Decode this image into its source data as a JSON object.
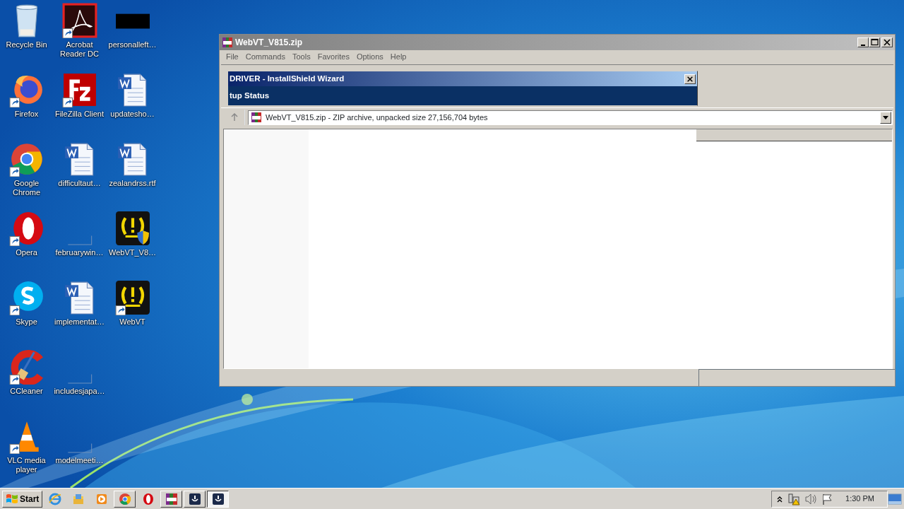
{
  "desktop": {
    "icons": [
      {
        "label": "Recycle Bin",
        "kind": "recycle",
        "shortcut": false
      },
      {
        "label": "Firefox",
        "kind": "firefox",
        "shortcut": true
      },
      {
        "label": "Google Chrome",
        "kind": "chrome",
        "shortcut": true
      },
      {
        "label": "Opera",
        "kind": "opera",
        "shortcut": true
      },
      {
        "label": "Skype",
        "kind": "skype",
        "shortcut": true
      },
      {
        "label": "CCleaner",
        "kind": "ccleaner",
        "shortcut": true
      },
      {
        "label": "VLC media player",
        "kind": "vlc",
        "shortcut": true
      },
      {
        "label": "Acrobat Reader DC",
        "kind": "acrobat",
        "shortcut": true
      },
      {
        "label": "FileZilla Client",
        "kind": "filezilla",
        "shortcut": true
      },
      {
        "label": "difficultaut…",
        "kind": "word",
        "shortcut": false
      },
      {
        "label": "februarywin…",
        "kind": "blank",
        "shortcut": false
      },
      {
        "label": "implementat…",
        "kind": "word",
        "shortcut": false
      },
      {
        "label": "includesjapa…",
        "kind": "blank",
        "shortcut": false
      },
      {
        "label": "modelmeeti…",
        "kind": "blank",
        "shortcut": false
      },
      {
        "label": "personalleft…",
        "kind": "black",
        "shortcut": false
      },
      {
        "label": "updatesho…",
        "kind": "word",
        "shortcut": false
      },
      {
        "label": "zealandrss.rtf",
        "kind": "word",
        "shortcut": false
      },
      {
        "label": "WebVT_V8…",
        "kind": "webvt-shield",
        "shortcut": false
      },
      {
        "label": "WebVT",
        "kind": "webvt",
        "shortcut": true
      }
    ]
  },
  "window": {
    "title": "WebVT_V815.zip",
    "menu": [
      "File",
      "Commands",
      "Tools",
      "Favorites",
      "Options",
      "Help"
    ],
    "wizard": {
      "title": "DRIVER - InstallShield Wizard",
      "heading": "tup Status"
    },
    "address": "WebVT_V815.zip - ZIP archive, unpacked size 27,156,704 bytes"
  },
  "taskbar": {
    "start": "Start",
    "buttons": [
      {
        "kind": "ie"
      },
      {
        "kind": "explorer"
      },
      {
        "kind": "media"
      },
      {
        "kind": "chrome",
        "selected": false
      },
      {
        "kind": "opera"
      },
      {
        "kind": "winrar",
        "selected": false
      },
      {
        "kind": "webvt",
        "selected": false
      },
      {
        "kind": "webvt",
        "selected": true
      }
    ],
    "time": "1:30 PM"
  }
}
